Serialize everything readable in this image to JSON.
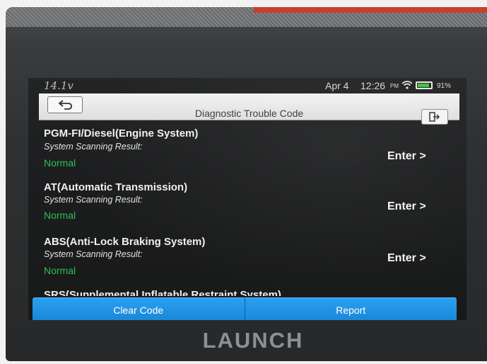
{
  "status_bar": {
    "voltage": "14.1v",
    "date": "Apr 4",
    "time": "12:26",
    "ampm": "PM",
    "battery_percent": "91%",
    "battery_level": 0.91,
    "icons": [
      "wifi-icon",
      "battery-icon"
    ]
  },
  "header": {
    "title": "Diagnostic Trouble Code",
    "back_icon": "back-arrow-icon",
    "exit_icon": "exit-icon"
  },
  "systems": [
    {
      "name": "PGM-FI/Diesel(Engine System)",
      "scan_label": "System Scanning Result:",
      "status": "Normal",
      "action": "Enter >"
    },
    {
      "name": "AT(Automatic Transmission)",
      "scan_label": "System Scanning Result:",
      "status": "Normal",
      "action": "Enter >"
    },
    {
      "name": "ABS(Anti-Lock Braking System)",
      "scan_label": "System Scanning Result:",
      "status": "Normal",
      "action": "Enter >"
    },
    {
      "name": "SRS(Supplemental Inflatable Restraint System)"
    }
  ],
  "bottom_buttons": {
    "clear": "Clear Code",
    "report": "Report"
  },
  "device": {
    "brand": "LAUNCH"
  },
  "colors": {
    "accent": "#1a86d8",
    "status_normal": "#2fbf55",
    "header_bg": "#e8e8e8"
  }
}
